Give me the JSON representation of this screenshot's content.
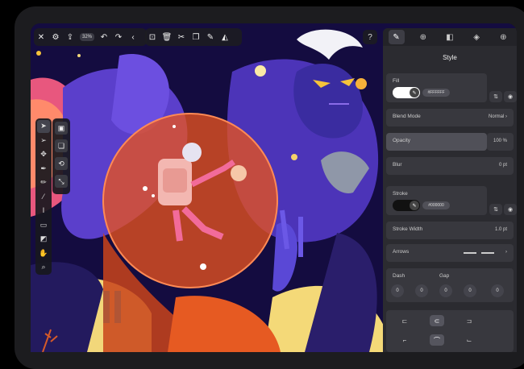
{
  "toolbar": {
    "zoom": "32%",
    "help": "?"
  },
  "panel": {
    "title": "Style",
    "fill": {
      "label": "Fill",
      "hex": "#FFFFFF"
    },
    "blend": {
      "label": "Blend Mode",
      "value": "Normal"
    },
    "opacity": {
      "label": "Opacity",
      "value": "100 %"
    },
    "blur": {
      "label": "Blur",
      "value": "0 pt"
    },
    "stroke": {
      "label": "Stroke",
      "hex": "#000000"
    },
    "stroke_width": {
      "label": "Stroke Width",
      "value": "1.0 pt"
    },
    "arrows": {
      "label": "Arrows"
    },
    "dash": {
      "label": "Dash",
      "values": [
        "0",
        "0",
        "0"
      ]
    },
    "gap": {
      "label": "Gap",
      "values": [
        "0",
        "0"
      ]
    }
  },
  "colors": {
    "panel_bg": "#2b2b30",
    "accent_orange": "#e6521f",
    "bg_navy": "#120a3a"
  },
  "icons": {
    "top_left": [
      "close-icon",
      "settings-icon",
      "share-icon"
    ],
    "top_mid": [
      "undo-icon",
      "redo-icon",
      "collapse-icon",
      "frame-icon",
      "delete-icon",
      "cut-icon",
      "copy-icon",
      "paste-style-icon",
      "fill-bucket-icon"
    ],
    "tools": [
      "select-icon",
      "direct-select-icon",
      "node-icon",
      "pen-icon",
      "pencil-icon",
      "brush-icon",
      "text-icon",
      "rectangle-icon",
      "eraser-icon",
      "hand-icon",
      "zoom-icon"
    ],
    "tabs": [
      "style-tab-icon",
      "transform-tab-icon",
      "boolean-tab-icon",
      "layers-tab-icon",
      "add-tab-icon"
    ]
  }
}
